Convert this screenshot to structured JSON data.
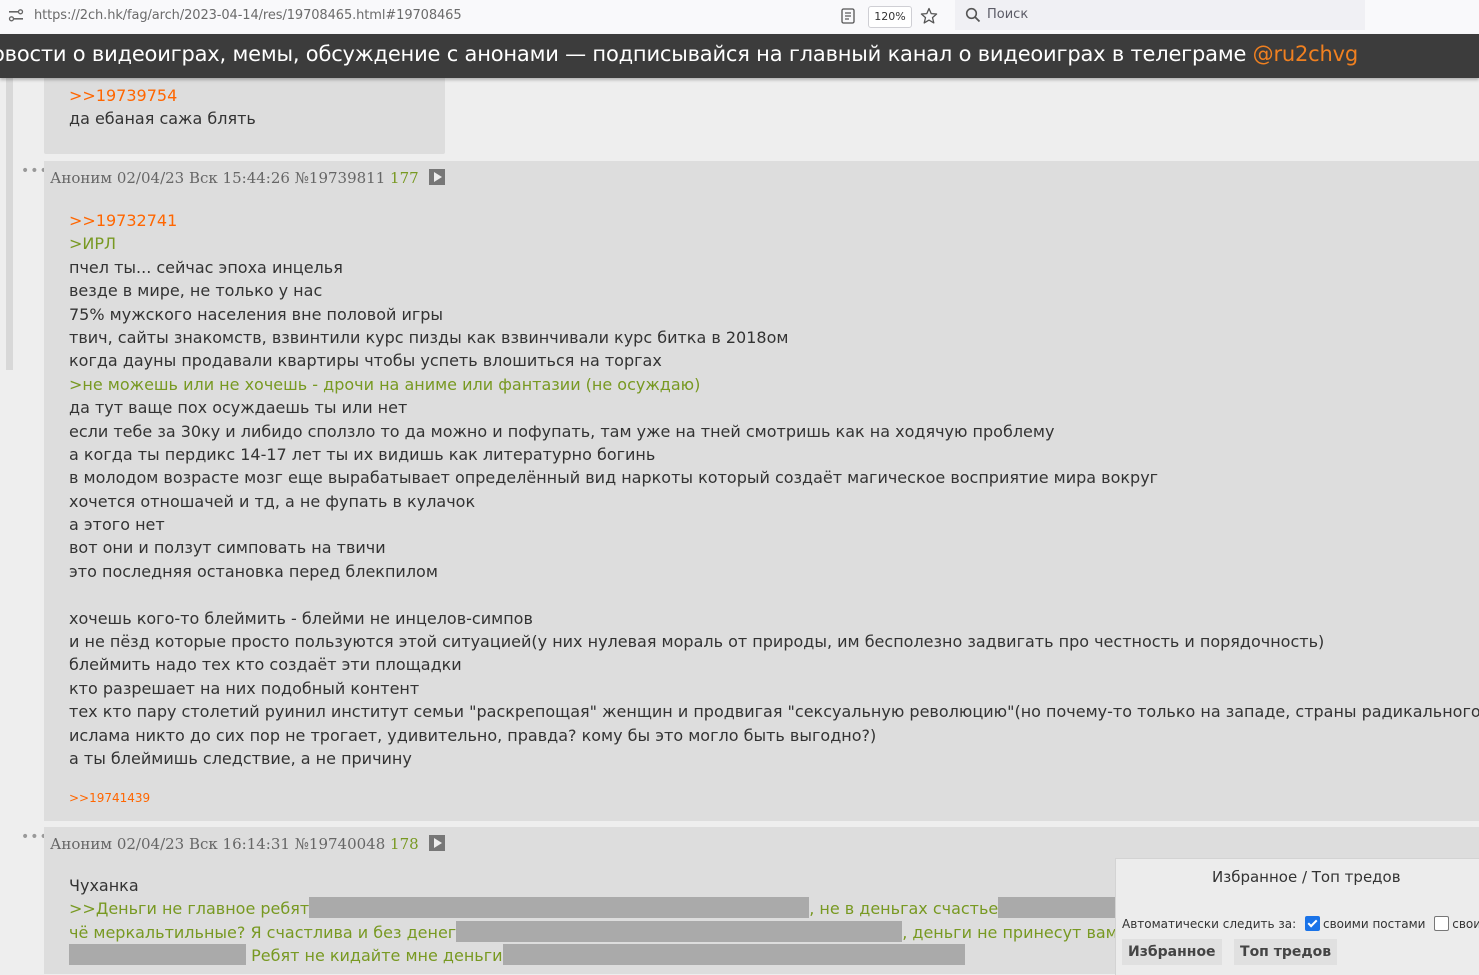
{
  "browser": {
    "url": "https://2ch.hk/fag/arch/2023-04-14/res/19708465.html#19708465",
    "zoom": "120%",
    "search_placeholder": "Поиск"
  },
  "banner": {
    "text": "овости о видеоиграх, мемы, обсуждение с анонами — подписывайся на главный канал о видеоиграх в телеграме ",
    "link": "@ru2chvg",
    "link_color": "#f08020"
  },
  "post_top": {
    "reply_link": ">>19739754",
    "text": "да ебаная сажа блять"
  },
  "post1": {
    "author": "Аноним",
    "date": "02/04/23 Вск 15:44:26",
    "id": "№19739811",
    "num": "177",
    "reply_link": ">>19732741",
    "lines": [
      {
        "t": ">ИРЛ",
        "q": true
      },
      {
        "t": "пчел ты... сейчас эпоха инцелья",
        "q": false
      },
      {
        "t": "везде в мире, не только у нас",
        "q": false
      },
      {
        "t": "75% мужского населения вне половой игры",
        "q": false
      },
      {
        "t": "твич, сайты знакомств, взвинтили курс пизды как взвинчивали курс битка в 2018ом",
        "q": false
      },
      {
        "t": "когда дауны продавали квартиры чтобы успеть влошиться на торгах",
        "q": false
      },
      {
        "t": ">не можешь или не хочешь - дрочи на аниме или фантазии (не осуждаю)",
        "q": true
      },
      {
        "t": "да тут ваще пох осуждаешь ты или нет",
        "q": false
      },
      {
        "t": "если тебе за 30ку и либидо сползло то да можно и пофупать, там уже на тней смотришь как на ходячую проблему",
        "q": false
      },
      {
        "t": "а когда ты пердикс 14-17 лет ты их видишь как литературно богинь",
        "q": false
      },
      {
        "t": "в молодом возрасте мозг еще вырабатывает определённый вид наркоты который создаёт магическое восприятие мира вокруг",
        "q": false
      },
      {
        "t": "хочется отношачей и тд, а не фупать в кулачок",
        "q": false
      },
      {
        "t": "а этого нет",
        "q": false
      },
      {
        "t": "вот они и ползут симповать на твичи",
        "q": false
      },
      {
        "t": "это последняя остановка перед блекпилом",
        "q": false
      },
      {
        "t": "",
        "q": false
      },
      {
        "t": "хочешь кого-то блеймить - блейми не инцелов-симпов",
        "q": false
      },
      {
        "t": "и не пёзд которые просто пользуются этой ситуацией(у них нулевая мораль от природы, им бесполезно задвигать про честность и порядочность)",
        "q": false
      },
      {
        "t": "блеймить надо тех кто создаёт эти площадки",
        "q": false
      },
      {
        "t": "кто разрешает на них подобный контент",
        "q": false
      },
      {
        "t": "тех кто пару столетий руинил институт семьи \"раскрепощая\" женщин и продвигая \"сексуальную революцию\"(но почему-то только на западе, страны радикального",
        "q": false
      },
      {
        "t": "ислама никто до сих пор не трогает, удивительно, правда? кому бы это могло быть выгодно?)",
        "q": false
      },
      {
        "t": "а ты блеймишь следствие, а не причину",
        "q": false
      }
    ],
    "backlink": ">>19741439"
  },
  "post2": {
    "author": "Аноним",
    "date": "02/04/23 Вск 16:14:31",
    "id": "№19740048",
    "num": "178",
    "line1": "Чуханка",
    "q1a": ">>Деньги не главное ребят",
    "q1b": ", не в деньгах счастье",
    "q2a": "чё меркальтильные? Я счастлива и без денег",
    "q2b": ", деньги не принесут вам с",
    "q3a": " Ребят не кидайте мне деньги"
  },
  "favorites": {
    "title": "Избранное / Топ тредов",
    "auto_label": "Автоматически следить за:",
    "opt1": "своими постами",
    "opt1_checked": true,
    "opt2": "своим тр",
    "opt2_checked": false,
    "tab1": "Избранное",
    "tab2": "Топ тредов"
  }
}
